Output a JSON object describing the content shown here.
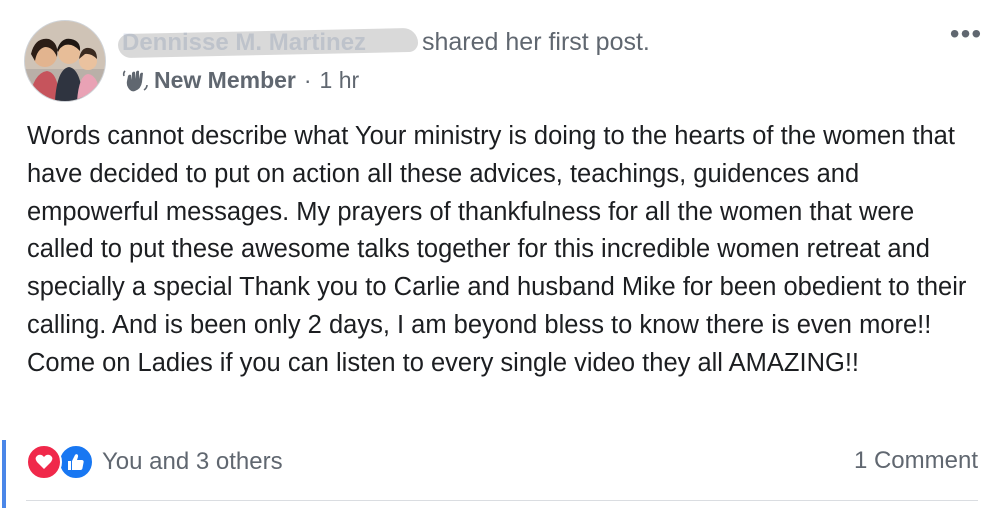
{
  "post": {
    "author_redacted": "Dennisse M. Martinez",
    "action": "shared her first post.",
    "badge": "New Member",
    "separator": "·",
    "time": "1 hr",
    "more_label": "•••",
    "body": "Words cannot describe what Your ministry is doing to the hearts of the women that have decided to put on action all these advices, teachings, guidences and empowerful messages. My prayers of thankfulness for all the women that were called to put these awesome talks together for this incredible women retreat and specially a special Thank you to Carlie and husband Mike for been obedient to their calling. And is been only 2 days, I am beyond bless to know there is even more!! Come on Ladies if you can listen to every single video they all AMAZING!!"
  },
  "footer": {
    "reaction_text": "You and 3 others",
    "comments": "1 Comment",
    "reaction_icons": [
      "love-icon",
      "like-icon"
    ]
  },
  "colors": {
    "love": "#f0284a",
    "like": "#1877f2",
    "muted_text": "#606770",
    "body_text": "#1c1e21",
    "accent_bar": "#4a86e8"
  }
}
